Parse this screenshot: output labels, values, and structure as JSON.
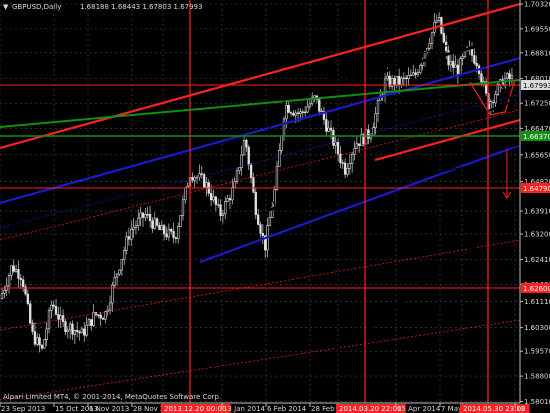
{
  "header": {
    "symbol": "GBPUSD,Daily",
    "ohlc": "1.68188 1.68443 1.67803 1.67993"
  },
  "watermark": "Alpari Limited MT4, © 2001-2014, MetaQuotes Software Corp.",
  "colors": {
    "background": "#000000",
    "grid": "#4a4a4a",
    "axis": "#c0c0c0",
    "text": "#d8d8d8",
    "bull": "#ffffff",
    "bear": "#e0e0e0",
    "red_line": "#ff2020",
    "blue_channel": "#1a1acc",
    "green_line": "#109010",
    "black_line": "#000000",
    "price_tag": "#dcdcdc",
    "level_tag": "#ff2020",
    "date_tag": "#ff2020"
  },
  "chart_data": {
    "type": "candlestick",
    "ylim": [
      1.5806,
      1.7032
    ],
    "y_ticks": [
      "1.70320",
      "1.69550",
      "1.68810",
      "1.68010",
      "1.67250",
      "1.66470",
      "1.65650",
      "1.64820",
      "1.63910",
      "1.63200",
      "1.62410",
      "1.61630",
      "1.61110",
      "1.60300",
      "1.59570",
      "1.58800",
      "1.58010"
    ],
    "x_ticks": [
      "23 Sep 2013",
      "15 Oct 2013",
      "6 Nov 2013",
      "28 Nov 2013",
      "2013.12.20 00:00",
      "13 Jan 2014",
      "6 Feb 2014",
      "28 Feb 2014",
      "2014.03.20 22:00",
      "15 Apr 2014",
      "7 May",
      "2014.05.30 23:00",
      "13"
    ],
    "highlighted_dates": [
      "2013.12.20 00:00",
      "2014.03.20 22:00",
      "2014.05.30 23:00"
    ],
    "current_price": "1.67993",
    "levels": [
      {
        "value": "1.66370",
        "color": "#109010"
      },
      {
        "value": "1.64790",
        "color": "#ff2020"
      },
      {
        "value": "1.62600",
        "color": "#ff2020"
      }
    ]
  }
}
